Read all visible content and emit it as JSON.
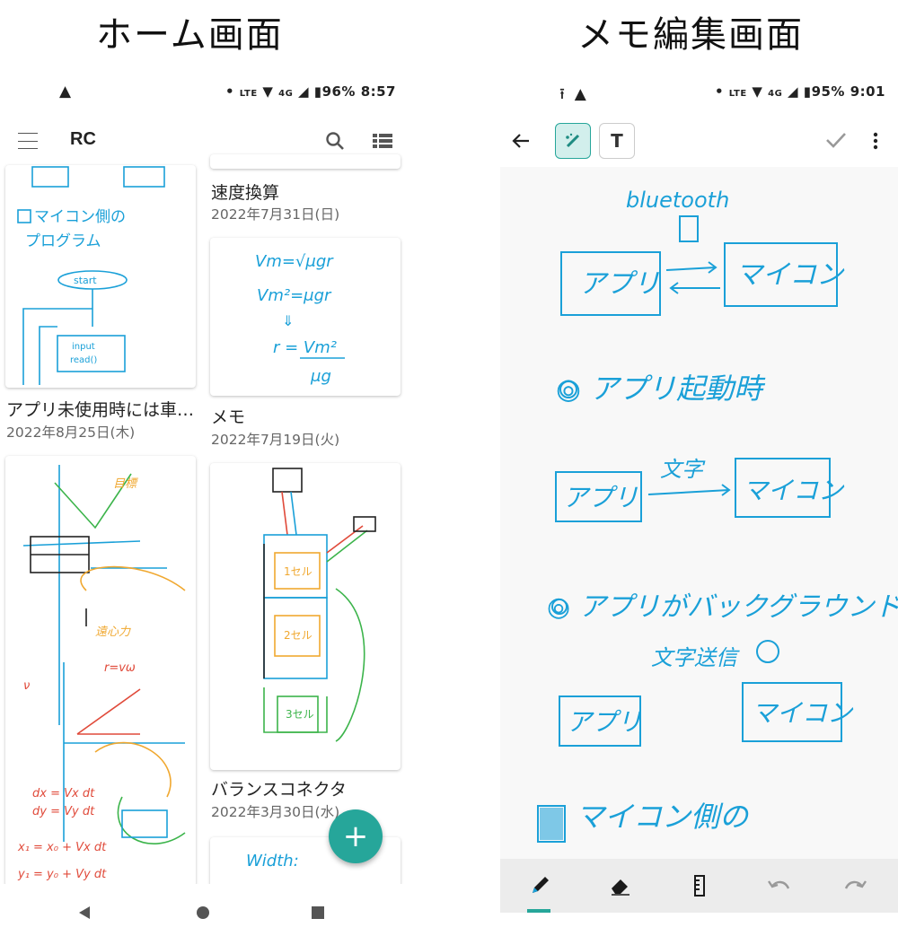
{
  "captions": {
    "home": "ホーム画面",
    "editor": "メモ編集画面"
  },
  "home": {
    "status": {
      "left_icon": "warning-icon",
      "right_text": "96% 8:57"
    },
    "appbar": {
      "title": "RC",
      "icons": [
        "menu-icon",
        "search-icon",
        "view-list-icon"
      ]
    },
    "notes": [
      {
        "title": "アプリ未使用時には車…",
        "date": "2022年8月25日(木)"
      },
      {
        "title": "速度換算",
        "date": "2022年7月31日(日)"
      },
      {
        "title": "メモ",
        "date": "2022年7月19日(火)"
      },
      {
        "title": "バランスコネクタ",
        "date": "2022年3月30日(水)"
      }
    ],
    "handwriting": {
      "card1": [
        "マイコン側の",
        "プログラム",
        "start",
        "input",
        "read()"
      ],
      "card_memo": [
        "Vm=√μgr",
        "Vm²=μgr",
        "r = Vm²",
        "μg"
      ],
      "card_bottom": [
        "Width:"
      ]
    },
    "fab_label": "+",
    "nav": [
      "back-triangle-icon",
      "home-circle-icon",
      "recents-square-icon"
    ]
  },
  "editor": {
    "status": {
      "left_icons": [
        "upload-icon",
        "warning-icon"
      ],
      "right_text": "95% 9:01"
    },
    "toolbar_icons": [
      "back-arrow-icon",
      "brush-mode-icon",
      "text-mode-icon",
      "check-icon",
      "more-vert-icon"
    ],
    "text_mode_label": "T",
    "handwriting": {
      "bluetooth": "bluetooth",
      "app1": "アプリ",
      "mcu1": "マイコン",
      "launch": "◎ アプリ起動時",
      "app2": "アプリ",
      "send_label": "文字",
      "mcu2": "マイコン",
      "background": "◎ アプリがバックグラウンド",
      "send2": "文字送信",
      "app3": "アプリ",
      "mcu3": "マイコン",
      "mcu_side": "マイコン側の"
    },
    "bottom_tools": [
      "pen-icon",
      "eraser-icon",
      "ruler-icon",
      "undo-icon",
      "redo-icon"
    ]
  },
  "colors": {
    "ink": "#1aa0d8",
    "accent": "#26a69a",
    "red_ink": "#e04a3a",
    "orange_ink": "#f0a830",
    "green_ink": "#3cb44b"
  }
}
